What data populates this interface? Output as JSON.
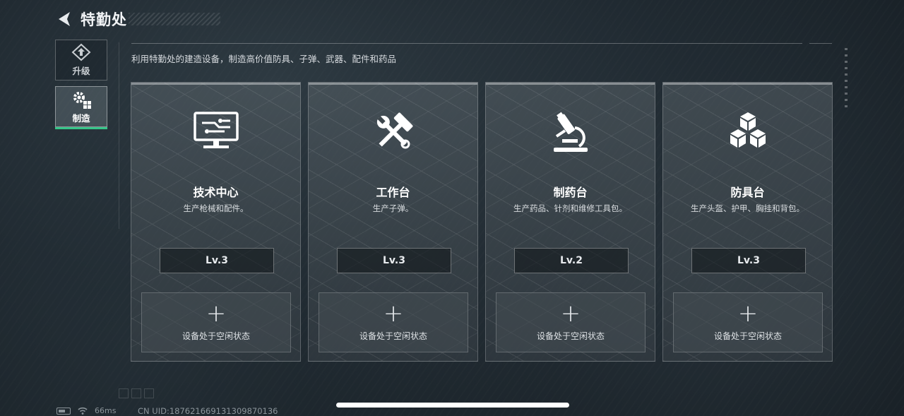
{
  "header": {
    "title": "特勤处",
    "back_icon": "back-arrow-icon"
  },
  "subtitle": "利用特勤处的建造设备，制造高价值防具、子弹、武器、配件和药品",
  "nav": {
    "items": [
      {
        "label": "升级",
        "icon": "upgrade-icon",
        "active": false
      },
      {
        "label": "制造",
        "icon": "gear-icon",
        "active": true
      }
    ]
  },
  "stations": [
    {
      "name": "技术中心",
      "desc": "生产枪械和配件。",
      "level": "Lv.3",
      "icon": "monitor-icon",
      "slot_status": "设备处于空闲状态"
    },
    {
      "name": "工作台",
      "desc": "生产子弹。",
      "level": "Lv.3",
      "icon": "hammer-wrench-icon",
      "slot_status": "设备处于空闲状态"
    },
    {
      "name": "制药台",
      "desc": "生产药品、针剂和维修工具包。",
      "level": "Lv.2",
      "icon": "microscope-icon",
      "slot_status": "设备处于空闲状态"
    },
    {
      "name": "防具台",
      "desc": "生产头盔、护甲、胸挂和背包。",
      "level": "Lv.3",
      "icon": "cubes-icon",
      "slot_status": "设备处于空闲状态"
    }
  ],
  "status_bar": {
    "ping": "66ms",
    "uid": "CN UID:187621669131309870136"
  },
  "colors": {
    "active_accent": "#35c488"
  }
}
